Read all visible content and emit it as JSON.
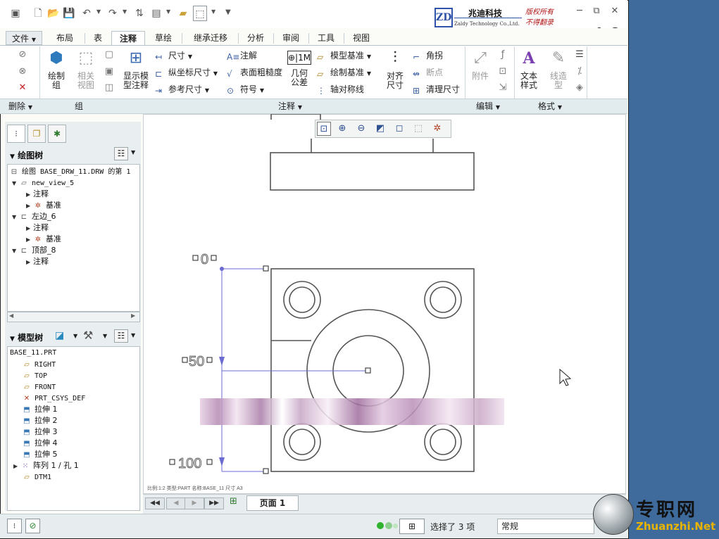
{
  "brand": {
    "logo_letters": "ZD",
    "name_cn": "兆迪科技",
    "name_en": "Zaldy Technology Co.,Ltd.",
    "copyright_l1": "版权所有",
    "copyright_l2": "不得翻录"
  },
  "tabs": [
    "文件",
    "布局",
    "表",
    "注释",
    "草绘",
    "继承迁移",
    "分析",
    "审阅",
    "工具",
    "视图"
  ],
  "active_tab": "注释",
  "ribbon": {
    "draw_group": "绘制组",
    "related_view": "相关视图",
    "show_model_anno": "显示模型注释",
    "dim": "尺寸",
    "ord_dim": "纵坐标尺寸",
    "ref_dim": "参考尺寸",
    "note": "注解",
    "surface_finish": "表面粗糙度",
    "symbol": "符号",
    "geo_tol": "几何公差",
    "model_datum": "模型基准",
    "draw_datum": "绘制基准",
    "axis_sym": "轴对称线",
    "align_dim": "对齐尺寸",
    "angle": "角拐",
    "break_point": "断点",
    "clean_dim": "清理尺寸",
    "attach": "附件",
    "text_style": "文本样式",
    "line_style": "线造型"
  },
  "groups": {
    "delete": "删除",
    "group": "组",
    "annotate": "注释",
    "edit": "编辑",
    "format": "格式"
  },
  "drawing_tree": {
    "title": "绘图树",
    "items": [
      "绘图 BASE_DRW_11.DRW 的第 1",
      "new_view_5",
      "注释",
      "基准",
      "左边_6",
      "注释",
      "基准",
      "顶部_8",
      "注释"
    ]
  },
  "model_tree": {
    "title": "模型树",
    "items": [
      "BASE_11.PRT",
      "RIGHT",
      "TOP",
      "FRONT",
      "PRT_CSYS_DEF",
      "拉伸 1",
      "拉伸 2",
      "拉伸 3",
      "拉伸 4",
      "拉伸 5",
      "阵列 1 / 孔 1",
      "DTM1"
    ]
  },
  "canvas": {
    "dim_top": "0",
    "dim_mid": "50",
    "dim_bot": "100",
    "footer": "比例:1:2     类型:PART     名称:BASE_11     尺寸 A3"
  },
  "sheet": {
    "page": "页面 1"
  },
  "status": {
    "message": "选择了 3 项",
    "filter": "常规"
  },
  "watermark": {
    "text": "专职网",
    "url": "Zhuanzhi.Net"
  }
}
